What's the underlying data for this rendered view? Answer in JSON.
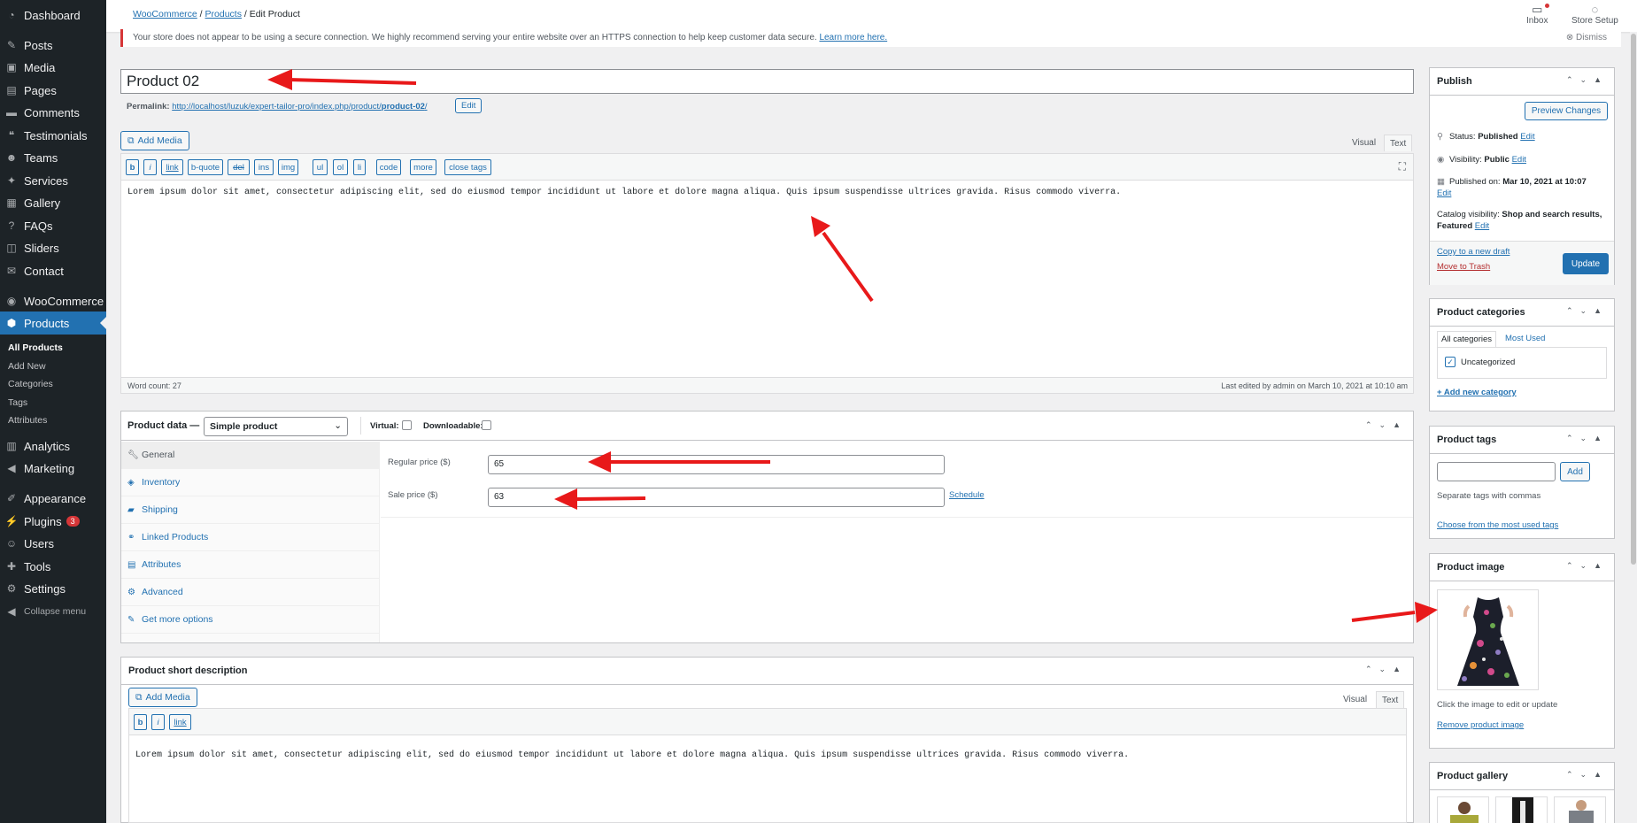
{
  "sidebar": {
    "items": [
      {
        "label": "Dashboard",
        "icon": "dashboard-icon"
      },
      {
        "label": "Posts",
        "icon": "pin-icon"
      },
      {
        "label": "Media",
        "icon": "media-icon"
      },
      {
        "label": "Pages",
        "icon": "page-icon"
      },
      {
        "label": "Comments",
        "icon": "comment-icon"
      },
      {
        "label": "Testimonials",
        "icon": "testimonial-icon"
      },
      {
        "label": "Teams",
        "icon": "team-icon"
      },
      {
        "label": "Services",
        "icon": "services-icon"
      },
      {
        "label": "Gallery",
        "icon": "gallery-icon"
      },
      {
        "label": "FAQs",
        "icon": "faq-icon"
      },
      {
        "label": "Sliders",
        "icon": "slider-icon"
      },
      {
        "label": "Contact",
        "icon": "contact-icon"
      },
      {
        "label": "WooCommerce",
        "icon": "woocommerce-icon"
      },
      {
        "label": "Products",
        "icon": "products-icon"
      },
      {
        "label": "Analytics",
        "icon": "analytics-icon"
      },
      {
        "label": "Marketing",
        "icon": "marketing-icon"
      },
      {
        "label": "Appearance",
        "icon": "appearance-icon"
      },
      {
        "label": "Plugins",
        "icon": "plugins-icon",
        "badge": "3"
      },
      {
        "label": "Users",
        "icon": "users-icon"
      },
      {
        "label": "Tools",
        "icon": "tools-icon"
      },
      {
        "label": "Settings",
        "icon": "settings-icon"
      },
      {
        "label": "Collapse menu",
        "icon": "collapse-icon"
      }
    ],
    "submenu": [
      "All Products",
      "Add New",
      "Categories",
      "Tags",
      "Attributes"
    ],
    "accent": "#2271b1"
  },
  "topbar": {
    "breadcrumb": {
      "woocommerce": "WooCommerce",
      "separator": "/",
      "products": "Products",
      "current": "Edit Product"
    },
    "inbox": "Inbox",
    "store_setup": "Store Setup"
  },
  "notice": {
    "text": "Your store does not appear to be using a secure connection. We highly recommend serving your entire website over an HTTPS connection to help keep customer data secure.",
    "link": "Learn more here.",
    "dismiss": "Dismiss"
  },
  "post": {
    "title": "Product 02",
    "permalink_label": "Permalink:",
    "permalink_base": "http://localhost/luzuk/expert-tailor-pro/index.php/product/",
    "permalink_slug": "product-02",
    "permalink_end": "/",
    "permalink_edit": "Edit"
  },
  "editor": {
    "add_media": "Add Media",
    "tab_visual": "Visual",
    "tab_text": "Text",
    "quicktags": [
      "b",
      "i",
      "link",
      "b-quote",
      "del",
      "ins",
      "img",
      "ul",
      "ol",
      "li",
      "code",
      "more",
      "close tags"
    ],
    "content": "Lorem ipsum dolor sit amet, consectetur adipiscing elit, sed do eiusmod tempor incididunt ut labore et dolore magna aliqua. Quis ipsum suspendisse ultrices gravida. Risus commodo viverra.",
    "word_count": "Word count: 27",
    "last_edited": "Last edited by admin on March 10, 2021 at 10:10 am"
  },
  "product_data": {
    "label": "Product data —",
    "type": "Simple product",
    "virtual": "Virtual:",
    "downloadable": "Downloadable:",
    "tabs": [
      {
        "label": "General",
        "icon": "wrench-icon"
      },
      {
        "label": "Inventory",
        "icon": "tag-icon"
      },
      {
        "label": "Shipping",
        "icon": "truck-icon"
      },
      {
        "label": "Linked Products",
        "icon": "link-icon"
      },
      {
        "label": "Attributes",
        "icon": "list-icon"
      },
      {
        "label": "Advanced",
        "icon": "gear-icon"
      },
      {
        "label": "Get more options",
        "icon": "plugin-icon"
      }
    ],
    "regular_price_label": "Regular price ($)",
    "regular_price": "65",
    "sale_price_label": "Sale price ($)",
    "sale_price": "63",
    "schedule": "Schedule"
  },
  "short_description": {
    "title": "Product short description",
    "add_media": "Add Media",
    "tab_visual": "Visual",
    "tab_text": "Text",
    "quicktags": [
      "b",
      "i",
      "link"
    ],
    "content": "Lorem ipsum dolor sit amet, consectetur adipiscing elit, sed do eiusmod tempor incididunt ut labore et dolore magna aliqua. Quis ipsum suspendisse ultrices gravida. Risus commodo viverra."
  },
  "publish": {
    "title": "Publish",
    "preview": "Preview Changes",
    "status_label": "Status:",
    "status": "Published",
    "visibility_label": "Visibility:",
    "visibility": "Public",
    "published_label": "Published on:",
    "published": "Mar 10, 2021 at 10:07",
    "catalog_label": "Catalog visibility:",
    "catalog": "Shop and search results, Featured",
    "edit": "Edit",
    "copy": "Copy to a new draft",
    "trash": "Move to Trash",
    "update": "Update"
  },
  "categories": {
    "title": "Product categories",
    "tab_all": "All categories",
    "tab_used": "Most Used",
    "item": "Uncategorized",
    "add": "+ Add new category"
  },
  "tags": {
    "title": "Product tags",
    "add": "Add",
    "hint": "Separate tags with commas",
    "choose": "Choose from the most used tags"
  },
  "product_image": {
    "title": "Product image",
    "hint": "Click the image to edit or update",
    "remove": "Remove product image"
  },
  "gallery": {
    "title": "Product gallery"
  }
}
